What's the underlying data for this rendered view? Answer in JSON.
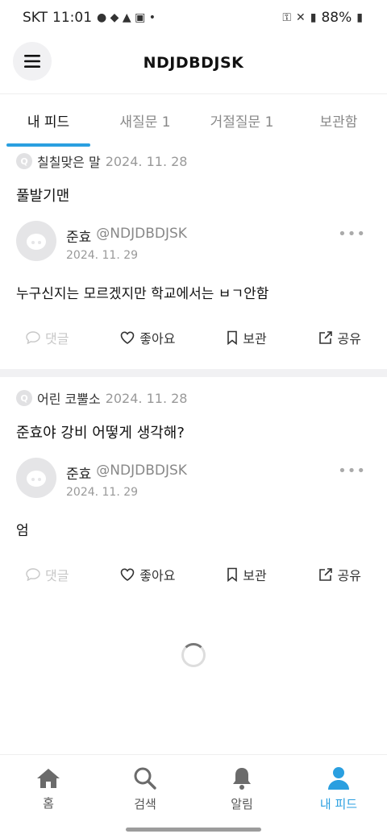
{
  "status_bar": {
    "carrier": "SKT",
    "time": "11:01",
    "battery": "88%"
  },
  "header": {
    "title": "NDJDBDJSK"
  },
  "tabs": [
    {
      "label": "내 피드",
      "active": true
    },
    {
      "label": "새질문 1",
      "active": false
    },
    {
      "label": "거절질문 1",
      "active": false
    },
    {
      "label": "보관함",
      "active": false
    }
  ],
  "posts": [
    {
      "q_badge": "Q",
      "question_author": "칠칠맞은 말",
      "question_date": "2024. 11. 28",
      "question_text": "풀발기맨",
      "answer_name": "준효",
      "answer_handle": "@NDJDBDJSK",
      "answer_date": "2024. 11. 29",
      "answer_text": "누구신지는 모르겠지만 학교에서는 ㅂㄱ안함"
    },
    {
      "q_badge": "Q",
      "question_author": "어린 코뿔소",
      "question_date": "2024. 11. 28",
      "question_text": "준효야 강비 어떻게 생각해?",
      "answer_name": "준효",
      "answer_handle": "@NDJDBDJSK",
      "answer_date": "2024. 11. 29",
      "answer_text": "엄"
    }
  ],
  "actions": {
    "comment": "댓글",
    "like": "좋아요",
    "bookmark": "보관",
    "share": "공유"
  },
  "bottom_nav": [
    {
      "label": "홈",
      "icon": "home-icon",
      "active": false
    },
    {
      "label": "검색",
      "icon": "search-icon",
      "active": false
    },
    {
      "label": "알림",
      "icon": "bell-icon",
      "active": false
    },
    {
      "label": "내 피드",
      "icon": "person-icon",
      "active": true
    }
  ],
  "colors": {
    "accent": "#2a9fe0",
    "muted": "#999999"
  }
}
